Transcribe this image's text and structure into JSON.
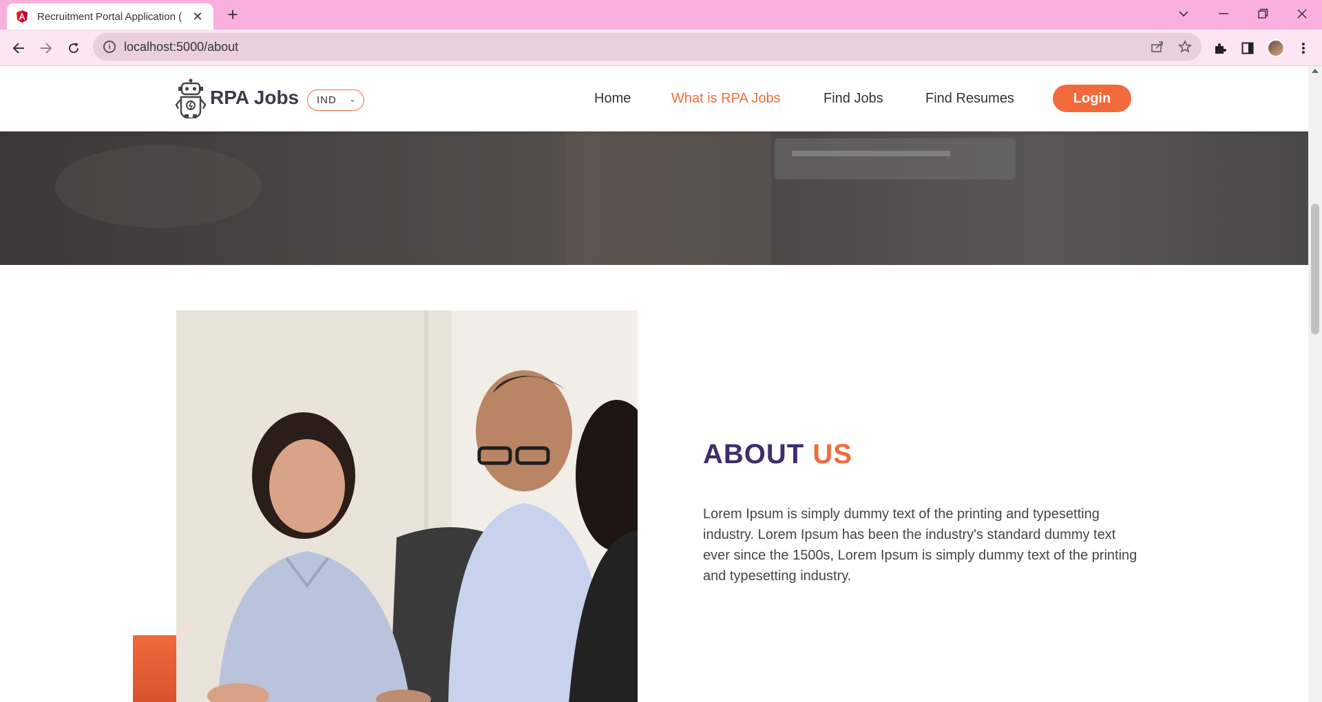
{
  "browser": {
    "tab_title": "Recruitment Portal Application (",
    "url": "localhost:5000/about"
  },
  "header": {
    "logo_text": "RPA Jobs",
    "country": "IND",
    "nav": [
      "Home",
      "What is RPA Jobs",
      "Find Jobs",
      "Find Resumes"
    ],
    "active_nav": "What is RPA Jobs",
    "login_label": "Login"
  },
  "about": {
    "title_main": "ABOUT",
    "title_accent": "US",
    "body": "Lorem Ipsum is simply dummy text of the printing and typesetting industry. Lorem Ipsum has been the industry's standard dummy text ever since the 1500s, Lorem Ipsum is simply dummy text of the printing and typesetting industry."
  },
  "colors": {
    "accent": "#f26a3b",
    "title_dark": "#3d2d6b",
    "tabbar": "#f9b0dc"
  }
}
